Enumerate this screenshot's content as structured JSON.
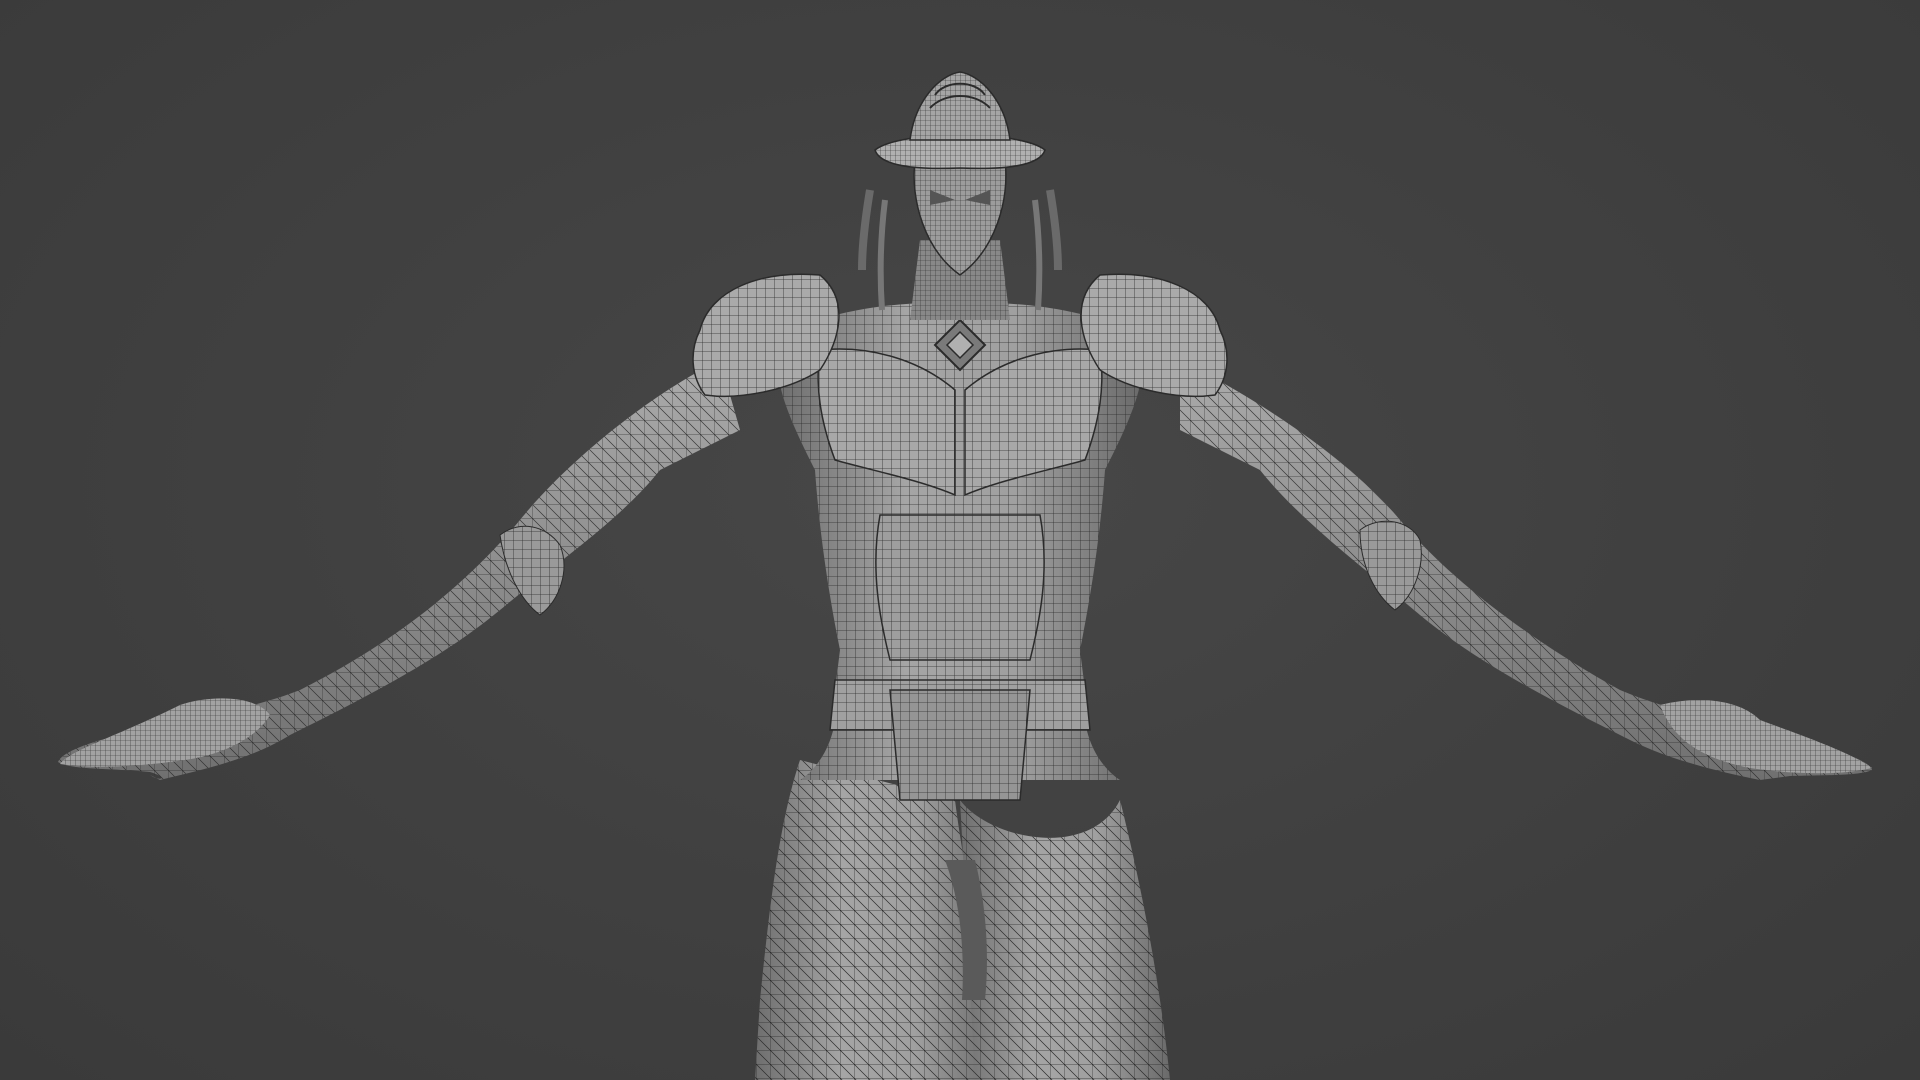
{
  "viewport": {
    "background_color": "#414141",
    "model_base_color": "#8c8c8c",
    "model_highlight_color": "#b4b4b4",
    "model_shadow_color": "#5a5a5a",
    "wire_color": "#2a2a2a",
    "shading_mode": "solid-with-wireframe",
    "subject": "armored-humanoid-t-pose"
  }
}
